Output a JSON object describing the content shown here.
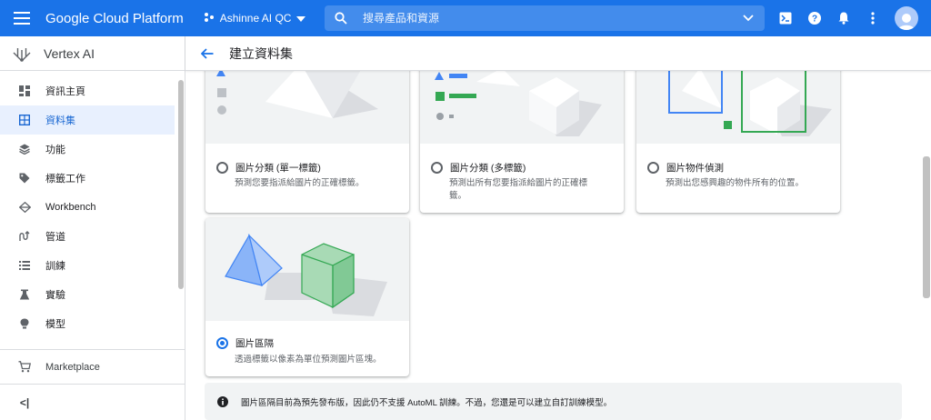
{
  "header": {
    "brand": "Google Cloud Platform",
    "project": "Ashinne AI QC",
    "search_placeholder": "搜尋產品和資源",
    "icons": [
      "terminal-icon",
      "help-icon",
      "notifications-icon",
      "more-vert-icon",
      "account-icon"
    ]
  },
  "sidebar": {
    "product": "Vertex AI",
    "items": [
      {
        "label": "資訊主頁",
        "icon": "dashboard-icon"
      },
      {
        "label": "資料集",
        "icon": "dataset-icon",
        "active": true
      },
      {
        "label": "功能",
        "icon": "features-icon"
      },
      {
        "label": "標籤工作",
        "icon": "label-icon"
      },
      {
        "label": "Workbench",
        "icon": "workbench-icon"
      },
      {
        "label": "管道",
        "icon": "pipelines-icon"
      },
      {
        "label": "訓練",
        "icon": "training-icon"
      },
      {
        "label": "實驗",
        "icon": "experiments-icon"
      },
      {
        "label": "模型",
        "icon": "models-icon"
      }
    ],
    "marketplace": "Marketplace",
    "collapse_label": "<|"
  },
  "main": {
    "title": "建立資料集",
    "options": [
      {
        "label": "圖片分類 (單一標籤)",
        "desc": "預測您要指派給圖片的正確標籤。",
        "selected": false
      },
      {
        "label": "圖片分類 (多標籤)",
        "desc": "預測出所有您要指派給圖片的正確標籤。",
        "selected": false
      },
      {
        "label": "圖片物件偵測",
        "desc": "預測出您感興趣的物件所有的位置。",
        "selected": false
      },
      {
        "label": "圖片區隔",
        "desc": "透過標籤以像素為單位預測圖片區塊。",
        "selected": true
      }
    ],
    "notice": "圖片區隔目前為預先發布版，因此仍不支援 AutoML 訓練。不過，您還是可以建立自訂訓練模型。"
  },
  "colors": {
    "accent": "#1a73e8",
    "active_bg": "#e8f0fe",
    "shape_blue": "#4285f4",
    "shape_green": "#34a853"
  }
}
